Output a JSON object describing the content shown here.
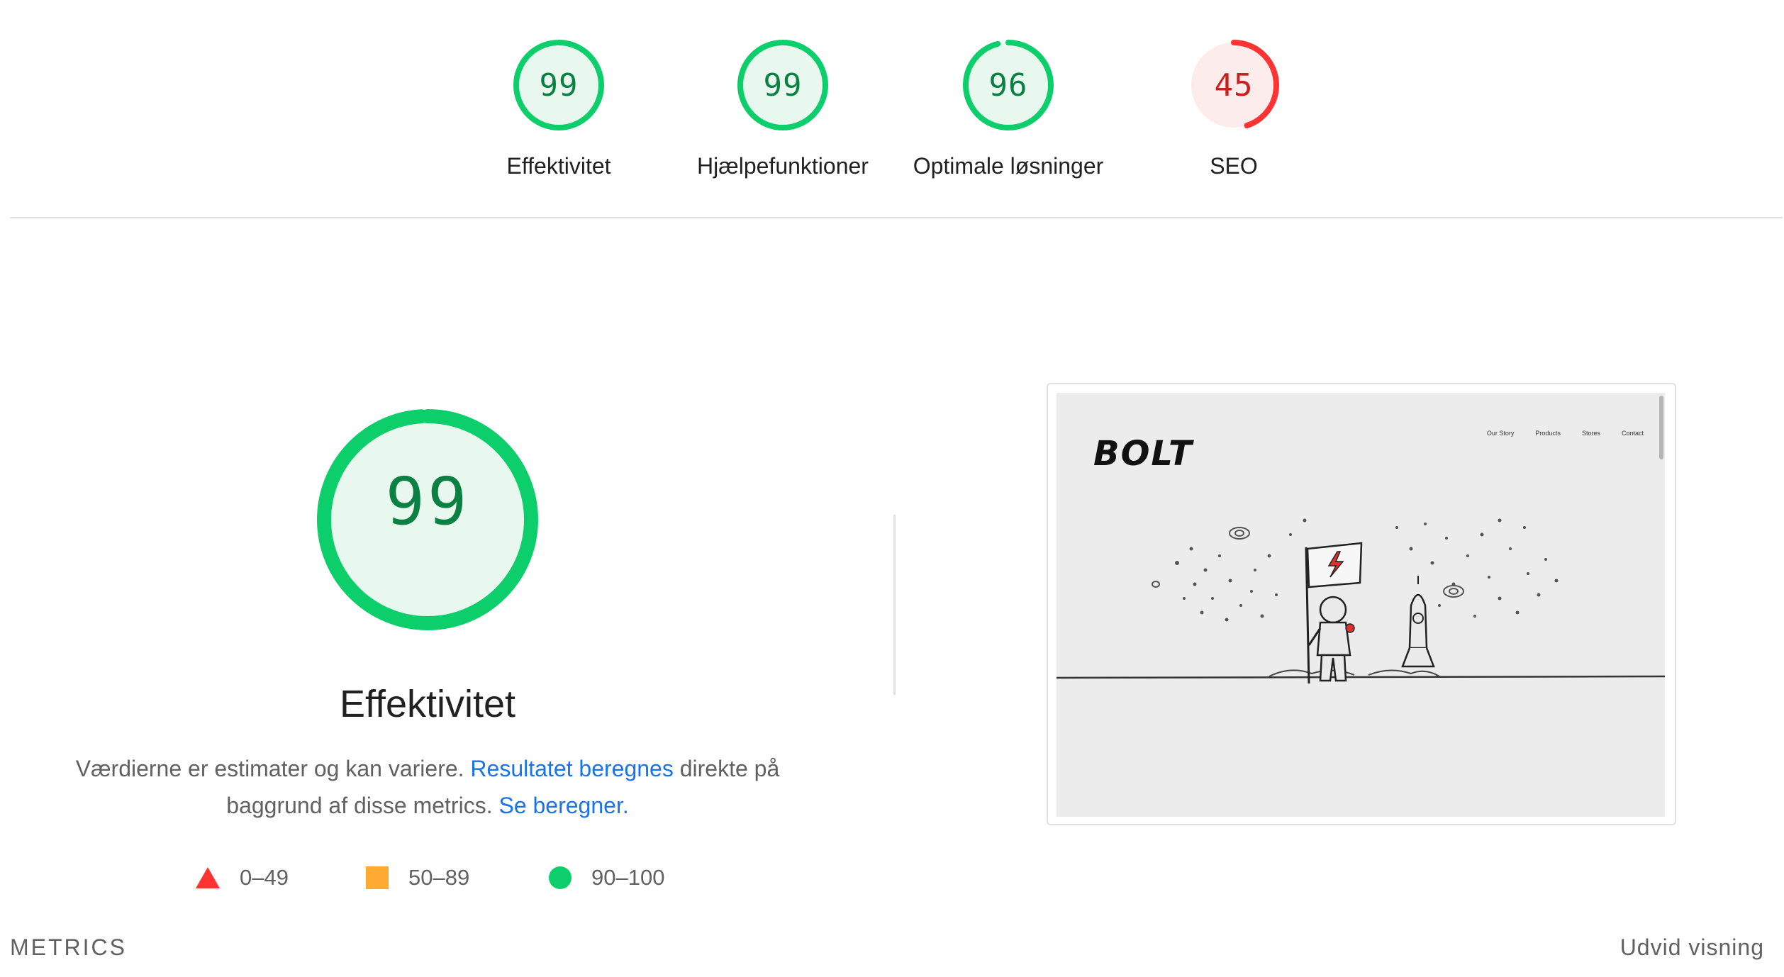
{
  "categories": [
    {
      "score": "99",
      "value": 0.99,
      "label": "Effektivitet",
      "color": "#0cce6b",
      "text_color": "#0b8043",
      "bg": "#e8f8ef"
    },
    {
      "score": "99",
      "value": 0.99,
      "label": "Hjælpefunktioner",
      "color": "#0cce6b",
      "text_color": "#0b8043",
      "bg": "#e8f8ef"
    },
    {
      "score": "96",
      "value": 0.96,
      "label": "Optimale løsninger",
      "color": "#0cce6b",
      "text_color": "#0b8043",
      "bg": "#e8f8ef"
    },
    {
      "score": "45",
      "value": 0.45,
      "label": "SEO",
      "color": "#ff3333",
      "text_color": "#c5221f",
      "bg": "#fdecec"
    }
  ],
  "performance": {
    "score": "99",
    "value": 0.99,
    "title": "Effektivitet",
    "desc_part1": "Værdierne er estimater og kan variere. ",
    "desc_link1": "Resultatet beregnes",
    "desc_part2": " direkte på baggrund af disse metrics. ",
    "desc_link2": "Se beregner."
  },
  "legend": [
    {
      "shape": "triangle",
      "range": "0–49",
      "color": "#ff3333"
    },
    {
      "shape": "square",
      "range": "50–89",
      "color": "#ffaa33"
    },
    {
      "shape": "circle",
      "range": "90–100",
      "color": "#0cce6b"
    }
  ],
  "screenshot": {
    "logo": "BOLT",
    "nav": [
      "Our Story",
      "Products",
      "Stores",
      "Contact"
    ]
  },
  "footer": {
    "metrics_label": "METRICS",
    "expand_label": "Udvid visning"
  }
}
